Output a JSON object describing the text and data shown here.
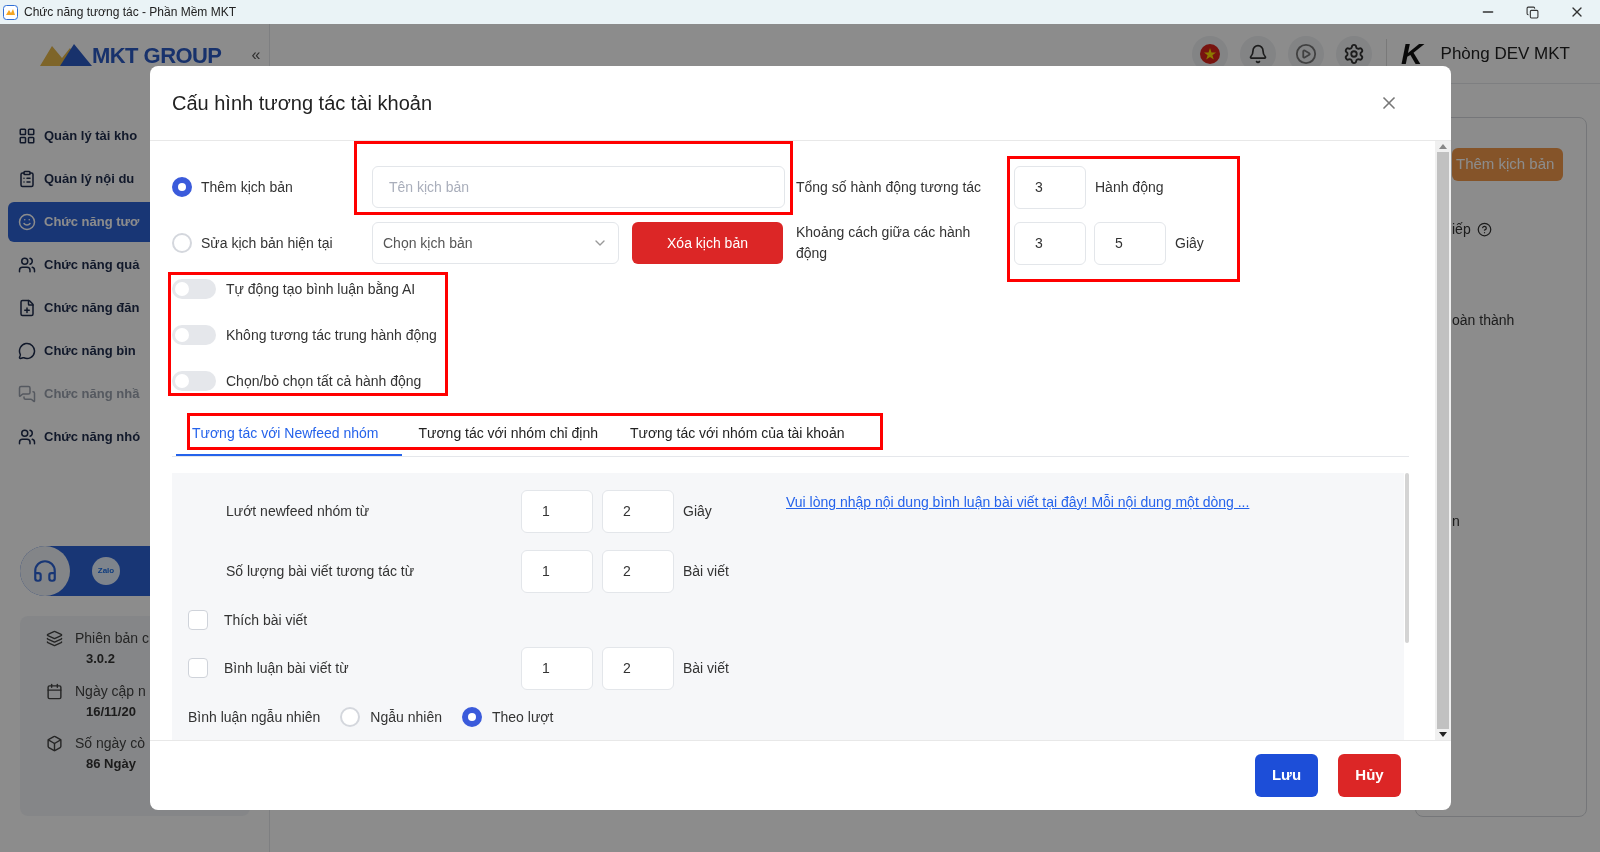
{
  "window": {
    "title": "Chức năng tương tác - Phần Mềm MKT"
  },
  "sidebar": {
    "logo": "MKT GROUP",
    "collapse": "«",
    "items": [
      {
        "label": "Quản lý tài kho",
        "selected": false,
        "disabled": false
      },
      {
        "label": "Quản lý nội du",
        "selected": false,
        "disabled": false
      },
      {
        "label": "Chức năng tươ",
        "selected": true,
        "disabled": false
      },
      {
        "label": "Chức năng quả",
        "selected": false,
        "disabled": false
      },
      {
        "label": "Chức năng đăn",
        "selected": false,
        "disabled": false
      },
      {
        "label": "Chức năng bìn",
        "selected": false,
        "disabled": false
      },
      {
        "label": "Chức năng nhầ",
        "selected": false,
        "disabled": true
      },
      {
        "label": "Chức năng nhó",
        "selected": false,
        "disabled": false
      }
    ],
    "support": {
      "zalo": "Zalo"
    },
    "info": [
      {
        "label": "Phiên bản c",
        "value": "3.0.2"
      },
      {
        "label": "Ngày cập n",
        "value": "16/11/20"
      },
      {
        "label": "Số ngày cò",
        "value": "86 Ngày"
      }
    ]
  },
  "header": {
    "logo_mark": "K",
    "user": "Phòng DEV MKT"
  },
  "background_panel": {
    "button": "Thêm kịch bản",
    "texts": [
      "iếp",
      "oàn thành",
      "n"
    ]
  },
  "modal": {
    "title": "Cấu hình tương tác tài khoản",
    "modes": [
      {
        "label": "Thêm kịch bản",
        "selected": true
      },
      {
        "label": "Sửa kịch bản hiện tại",
        "selected": false
      }
    ],
    "name_field": {
      "placeholder": "Tên kịch bản"
    },
    "script_select": {
      "placeholder": "Chọn kịch bản"
    },
    "delete_button": "Xóa kịch bản",
    "total_actions": {
      "label": "Tổng số hành động tương tác",
      "value": "3",
      "unit": "Hành động"
    },
    "action_interval": {
      "label": "Khoảng cách giữa các hành động",
      "from": "3",
      "to": "5",
      "unit": "Giây"
    },
    "toggles": [
      {
        "label": "Tự động tạo bình luận bằng AI",
        "on": false
      },
      {
        "label": "Không tương tác trung hành động",
        "on": false
      },
      {
        "label": "Chọn/bỏ chọn tất cả hành động",
        "on": false
      }
    ],
    "tabs": [
      {
        "label": "Tương tác với Newfeed nhóm",
        "selected": true
      },
      {
        "label": "Tương tác với nhóm chỉ định",
        "selected": false
      },
      {
        "label": "Tương tác với nhóm của tài khoản",
        "selected": false
      }
    ],
    "settings": [
      {
        "kind": "range",
        "label": "Lướt newfeed nhóm từ",
        "from": "1",
        "to": "2",
        "unit": "Giây"
      },
      {
        "kind": "range",
        "label": "Số lượng bài viết tương tác từ",
        "from": "1",
        "to": "2",
        "unit": "Bài viết"
      },
      {
        "kind": "checkbox",
        "label": "Thích bài viết",
        "checked": false
      },
      {
        "kind": "checkbox_range",
        "label": "Bình luận bài viết từ",
        "checked": false,
        "from": "1",
        "to": "2",
        "unit": "Bài viết"
      },
      {
        "kind": "radio_group",
        "label": "Bình luận ngẫu nhiên",
        "options": [
          {
            "label": "Ngẫu nhiên",
            "selected": false
          },
          {
            "label": "Theo lượt",
            "selected": true
          }
        ]
      }
    ],
    "comment_link": "Vui lòng nhập nội dung bình luận bài viết tại đây! Mỗi nội dung một dòng ...",
    "buttons": [
      {
        "label": "Lưu",
        "kind": "primary"
      },
      {
        "label": "Hủy",
        "kind": "danger"
      }
    ]
  }
}
